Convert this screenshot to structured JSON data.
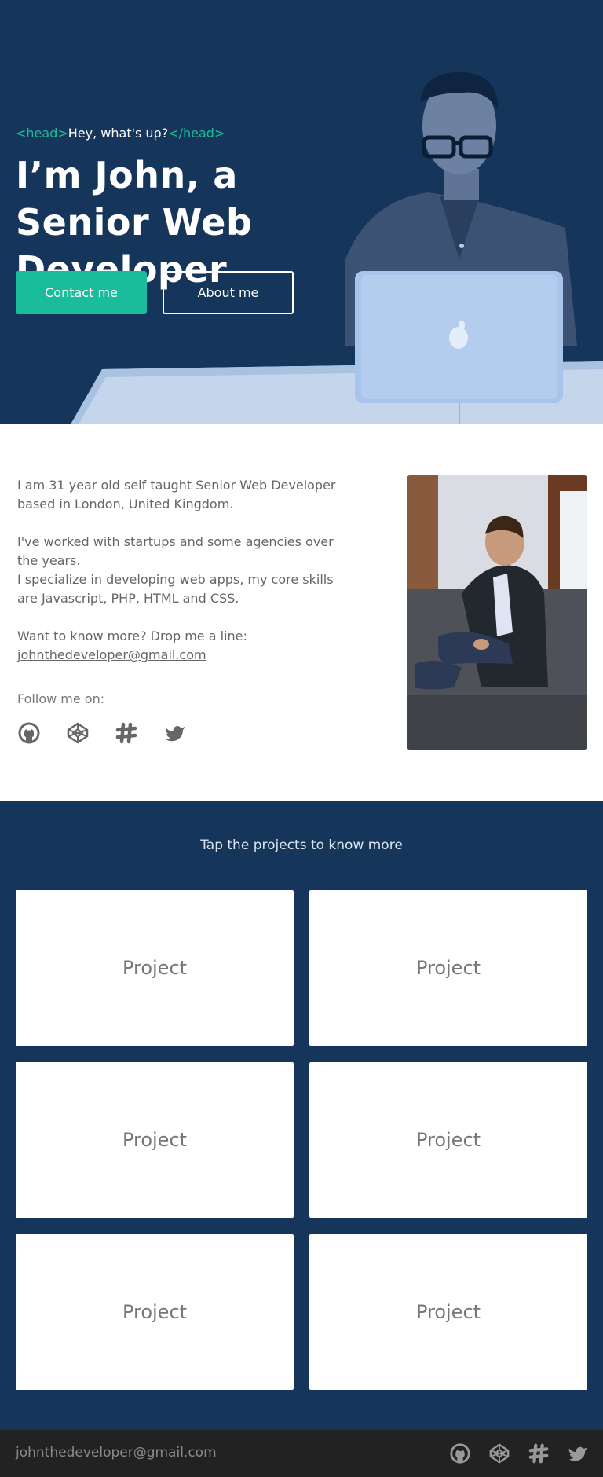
{
  "hero": {
    "eyebrow_open_tag": "<head>",
    "eyebrow_text": "Hey, what's up?",
    "eyebrow_close_tag": "</head>",
    "title": "I’m John, a Senior Web Developer",
    "contact_label": "Contact me",
    "about_label": "About me"
  },
  "about": {
    "para1": "I am 31 year old self taught Senior Web Developer based in London, United Kingdom.",
    "para2a": "I've worked with startups and some agencies over the years.",
    "para2b": "I specialize in developing web apps, my core skills are Javascript, PHP, HTML and CSS.",
    "para3": "Want to know more? Drop me a line:",
    "email": "johnthedeveloper@gmail.com",
    "follow_label": "Follow me on:",
    "social": [
      "github-icon",
      "codepen-icon",
      "slack-icon",
      "twitter-icon"
    ]
  },
  "projects": {
    "intro": "Tap the projects to know more",
    "cards": [
      "Project",
      "Project",
      "Project",
      "Project",
      "Project",
      "Project"
    ]
  },
  "footer": {
    "email": "johnthedeveloper@gmail.com"
  },
  "colors": {
    "navy": "#15355a",
    "accent": "#1abc9c",
    "footer": "#222222"
  }
}
